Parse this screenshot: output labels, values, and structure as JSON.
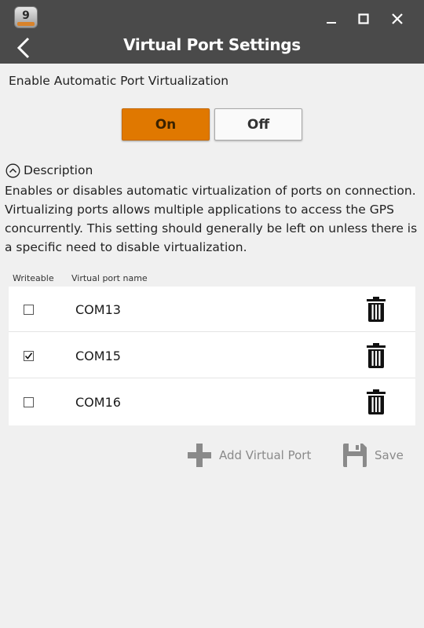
{
  "window": {
    "app_icon_text": "9",
    "title": "Virtual Port Settings",
    "colors": {
      "titlebar": "#4a4a4a",
      "accent": "#e07800",
      "background": "#f0f0f0"
    }
  },
  "icons": {
    "app": "app-icon",
    "minimize": "minimize-icon",
    "maximize": "maximize-icon",
    "close": "close-icon",
    "back": "back-arrow-icon",
    "description_toggle": "chevron-up-circle-icon",
    "delete": "trash-icon",
    "add": "plus-icon",
    "save": "floppy-disk-icon"
  },
  "virtualization": {
    "label": "Enable Automatic Port Virtualization",
    "on_label": "On",
    "off_label": "Off",
    "selected": "On"
  },
  "description": {
    "toggle_label": "Description",
    "expanded": true,
    "text": "Enables or disables automatic virtualization of ports on connection. Virtualizing ports allows multiple applications to access the GPS concurrently. This setting should generally be left on unless there is a specific need to disable virtualization."
  },
  "ports_table": {
    "columns": [
      "Writeable",
      "Virtual port name"
    ],
    "rows": [
      {
        "name": "COM13",
        "writeable": false
      },
      {
        "name": "COM15",
        "writeable": true
      },
      {
        "name": "COM16",
        "writeable": false
      }
    ]
  },
  "actions": {
    "add_label": "Add Virtual Port",
    "save_label": "Save"
  }
}
